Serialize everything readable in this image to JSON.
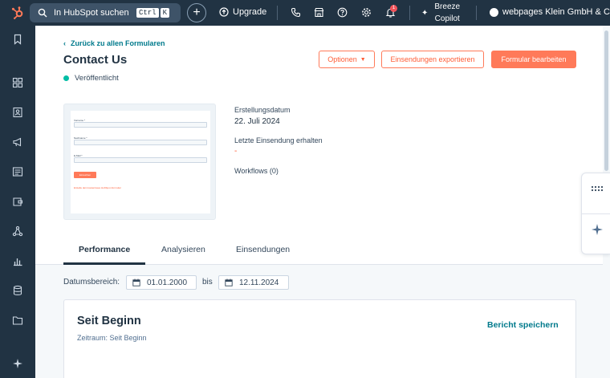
{
  "topbar": {
    "search_label": "In HubSpot suchen",
    "kbd": [
      "Ctrl",
      "K"
    ],
    "upgrade": "Upgrade",
    "notification_count": "1",
    "copilot_line1": "Breeze",
    "copilot_line2": "Copilot",
    "account_name": "webpages Klein GmbH & Co."
  },
  "header": {
    "back_link": "Zurück zu allen Formularen",
    "title": "Contact Us",
    "status": "Veröffentlicht",
    "btn_options": "Optionen",
    "btn_export": "Einsendungen exportieren",
    "btn_edit": "Formular bearbeiten"
  },
  "preview": {
    "field1": "Vorname *",
    "field2": "Nachname *",
    "field3": "E-Mail *",
    "submit": "Einreichen",
    "footer_link": "Erstelle dein kostenloses HubSpot-Formular",
    "footer_text": "Erstelle dein kostenloses HubSpot-Formular"
  },
  "meta": {
    "created_label": "Erstellungsdatum",
    "created_value": "22. Juli 2024",
    "last_label": "Letzte Einsendung erhalten",
    "last_value": "-",
    "workflows": "Workflows (0)"
  },
  "tabs": [
    "Performance",
    "Analysieren",
    "Einsendungen"
  ],
  "filter": {
    "label": "Datumsbereich:",
    "from": "01.01.2000",
    "bis": "bis",
    "to": "12.11.2024"
  },
  "card": {
    "title": "Seit Beginn",
    "subtitle": "Zeitraum: Seit Beginn",
    "save_report": "Bericht speichern"
  },
  "colors": {
    "nav_bg": "#213343",
    "accent": "#ff7a59",
    "link": "#007a8c",
    "published": "#00bda5"
  }
}
